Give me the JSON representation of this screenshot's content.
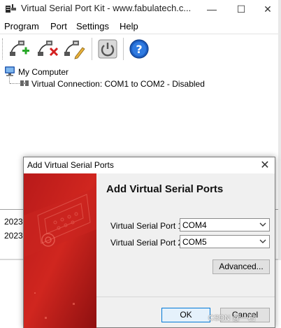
{
  "window": {
    "title": "Virtual Serial Port Kit - www.fabulatech.c...",
    "minimize_glyph": "—",
    "maximize_glyph": "☐",
    "close_glyph": "✕"
  },
  "menu": {
    "items": [
      {
        "label": "Program"
      },
      {
        "label": "Port"
      },
      {
        "label": "Settings"
      },
      {
        "label": "Help"
      }
    ]
  },
  "toolbar": {
    "buttons": [
      {
        "icon": "add-port-icon"
      },
      {
        "icon": "remove-port-icon"
      },
      {
        "icon": "edit-port-icon"
      },
      {
        "icon": "power-icon"
      },
      {
        "icon": "help-icon"
      }
    ]
  },
  "tree": {
    "root_label": "My Computer",
    "child_label": "Virtual Connection: COM1 to COM2 - Disabled"
  },
  "log": {
    "rows": [
      {
        "text": "2023"
      },
      {
        "text": "2023"
      }
    ]
  },
  "dialog": {
    "title": "Add Virtual Serial Ports",
    "close_glyph": "✕",
    "heading": "Add Virtual Serial Ports",
    "port1_label": "Virtual Serial Port 1:",
    "port1_value": "COM4",
    "port2_label": "Virtual Serial Port 2:",
    "port2_value": "COM5",
    "advanced_label": "Advanced...",
    "ok_label": "OK",
    "cancel_label": "Cancel"
  },
  "watermark": "CSDN @一石",
  "colors": {
    "banner_red": "#c8201e",
    "banner_dark": "#8e1010",
    "focus_blue": "#0078d7"
  }
}
